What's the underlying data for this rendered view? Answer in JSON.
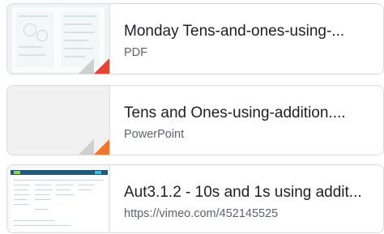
{
  "files": [
    {
      "title": "Monday Tens-and-ones-using-...",
      "subtitle": "PDF",
      "thumbnail": "pdf-worksheet-thumbnail",
      "type_icon": "pdf-corner-icon",
      "accent": "#e94235"
    },
    {
      "title": "Tens and Ones-using-addition....",
      "subtitle": "PowerPoint",
      "thumbnail": "blank-slide-thumbnail",
      "type_icon": "powerpoint-corner-icon",
      "accent": "#f4742b"
    },
    {
      "title": "Aut3.1.2 - 10s and 1s using addit...",
      "subtitle": "https://vimeo.com/452145525",
      "thumbnail": "vimeo-page-thumbnail",
      "type_icon": null,
      "accent": null
    }
  ]
}
